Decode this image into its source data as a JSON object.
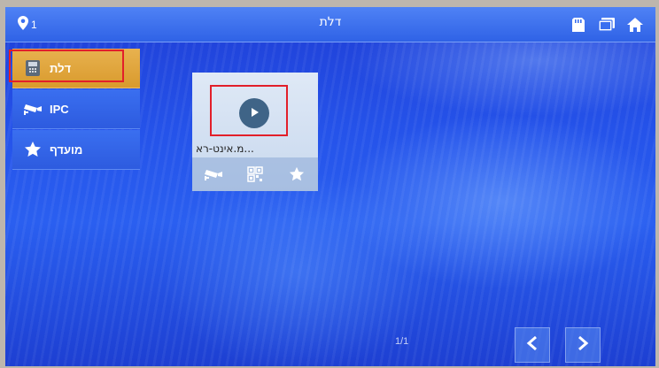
{
  "topbar": {
    "title": "דלת",
    "location_count": "1",
    "icons": [
      "location-pin-icon",
      "sd-card-icon",
      "monitor-icon",
      "home-icon"
    ]
  },
  "menu": {
    "items": [
      {
        "label": "דלת",
        "icon": "door-panel-icon",
        "active": true
      },
      {
        "label": "IPC",
        "icon": "cctv-camera-icon",
        "active": false
      },
      {
        "label": "מועדף",
        "icon": "star-icon",
        "active": false
      }
    ]
  },
  "tile": {
    "name": "...מ.אינט-רא",
    "actions": [
      "cctv-camera-icon",
      "qr-code-icon",
      "star-icon"
    ]
  },
  "pager": {
    "text": "1/1"
  },
  "colors": {
    "active_menu": "#e0a63d",
    "highlight": "#e21f2a",
    "bar": "#3a6ff0",
    "play_button": "#3f6487"
  }
}
